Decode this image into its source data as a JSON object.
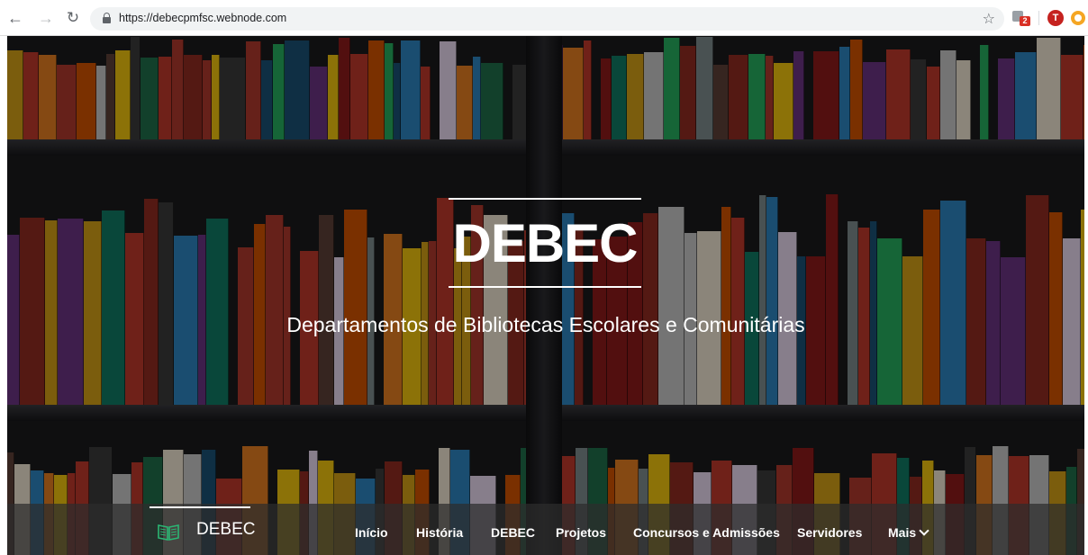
{
  "browser": {
    "url": "https://debecpmfsc.webnode.com",
    "extension_badge": "2",
    "profile_initial": "T",
    "icons": [
      "back-arrow-icon",
      "forward-arrow-icon",
      "reload-icon",
      "lock-icon",
      "star-icon",
      "translate-extension-icon",
      "profile-avatar",
      "extension-icon"
    ]
  },
  "hero": {
    "title": "DEBEC",
    "subtitle": "Departamentos de Bibliotecas Escolares e Comunitárias"
  },
  "site_nav": {
    "brand_label": "DEBEC",
    "brand_icon": "open-book-icon",
    "items": [
      {
        "label": "Início"
      },
      {
        "label": "História"
      },
      {
        "label": "DEBEC"
      },
      {
        "label": "Projetos"
      },
      {
        "label": "Concursos e Admissões"
      },
      {
        "label": "Servidores"
      },
      {
        "label": "Mais"
      }
    ],
    "more_icon": "chevron-down-icon"
  },
  "colors": {
    "accent_brand_icon": "#2bb673",
    "text": "#ffffff"
  }
}
